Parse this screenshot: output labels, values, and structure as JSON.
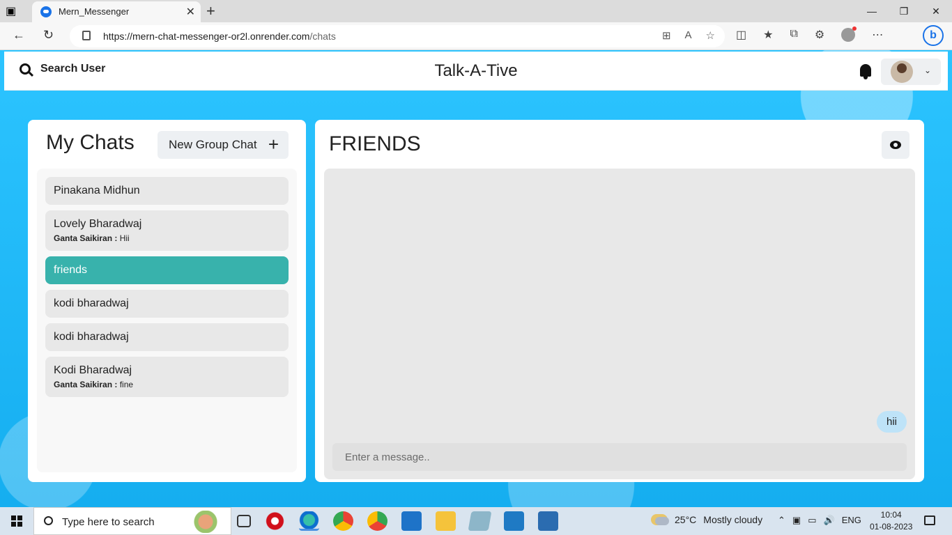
{
  "browser": {
    "tab_title": "Mern_Messenger",
    "url_host": "https://mern-chat-messenger-or2l.onrender.com",
    "url_path": "/chats",
    "new_tab_label": "+",
    "close_tab_label": "✕",
    "window_controls": [
      "—",
      "❐",
      "✕"
    ]
  },
  "header": {
    "search_label": "Search User",
    "app_title": "Talk-A-Tive"
  },
  "chats": {
    "title": "My Chats",
    "new_group_label": "New Group Chat",
    "items": [
      {
        "name": "Pinakana Midhun",
        "sender": "",
        "latest": ""
      },
      {
        "name": "Lovely Bharadwaj",
        "sender": "Ganta Saikiran :",
        "latest": "Hii"
      },
      {
        "name": "friends",
        "sender": "",
        "latest": "",
        "selected": true
      },
      {
        "name": "kodi bharadwaj",
        "sender": "",
        "latest": ""
      },
      {
        "name": "kodi bharadwaj",
        "sender": "",
        "latest": ""
      },
      {
        "name": "Kodi Bharadwaj",
        "sender": "Ganta Saikiran :",
        "latest": "fine"
      }
    ]
  },
  "chat_box": {
    "chat_name": "FRIENDS",
    "messages": [
      {
        "text": "hii",
        "own": true
      }
    ],
    "input_placeholder": "Enter a message.."
  },
  "taskbar": {
    "search_placeholder": "Type here to search",
    "weather_temp": "25°C",
    "weather_desc": "Mostly cloudy",
    "lang": "ENG",
    "time": "10:04",
    "date": "01-08-2023"
  },
  "colors": {
    "accent_selected": "#38b2ac",
    "bubble_own": "#bee3f8",
    "background": "#15aef0"
  }
}
